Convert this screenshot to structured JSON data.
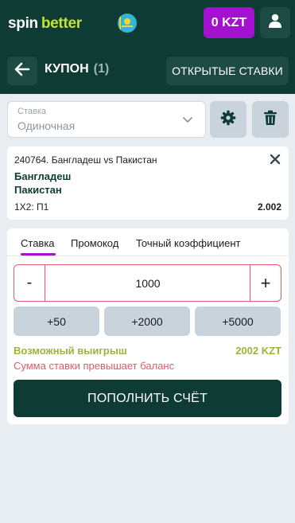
{
  "header": {
    "logo_part1": "spin",
    "logo_part2": "better",
    "flag_icon": "kazakhstan-flag-icon",
    "balance": "0 KZT",
    "user_icon": "user-icon",
    "colors": {
      "background": "#0e3b33",
      "balance": "#a312cf",
      "logo_accent": "#c3e332"
    }
  },
  "titlebar": {
    "back_icon": "arrow-left-icon",
    "title": "КУПОН",
    "count": "(1)",
    "open_bets_label": "ОТКРЫТЫЕ СТАВКИ"
  },
  "bet_type": {
    "label": "Ставка",
    "value": "Одиночная",
    "chevron_icon": "chevron-down-icon",
    "settings_icon": "gear-icon",
    "delete_icon": "trash-icon"
  },
  "event": {
    "title": "240764. Бангладеш vs Пакистан",
    "close_icon": "close-icon",
    "team1": "Бангладеш",
    "team2": "Пакистан",
    "market": "1X2: П1",
    "odds": "2.002"
  },
  "stake": {
    "tabs": [
      {
        "label": "Ставка",
        "active": true
      },
      {
        "label": "Промокод",
        "active": false
      },
      {
        "label": "Точный коэффициент",
        "active": false
      }
    ],
    "minus": "-",
    "plus": "+",
    "amount": "1000",
    "quick_amounts": [
      "+50",
      "+2000",
      "+5000"
    ],
    "possible_win_label": "Возможный выигрыш",
    "possible_win_value": "2002 KZT",
    "error": "Сумма ставки превышает баланс",
    "deposit_label": "ПОПОЛНИТЬ СЧЁТ",
    "colors": {
      "accent": "#a312cf",
      "error": "#e05a6a",
      "win": "#9fb33b"
    }
  }
}
